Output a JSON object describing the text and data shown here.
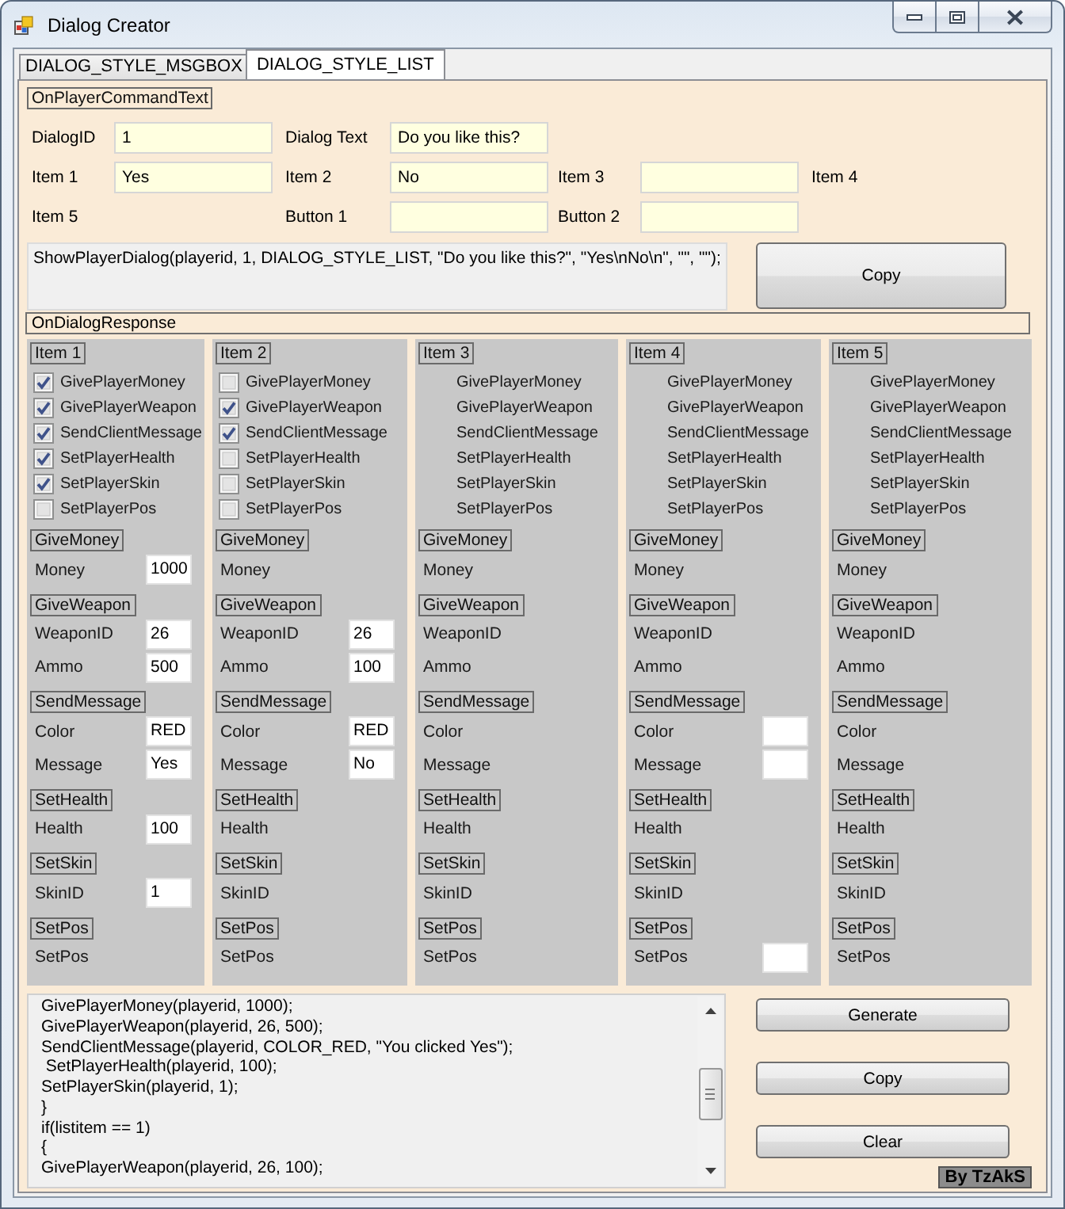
{
  "window": {
    "title": "Dialog Creator"
  },
  "tabs": [
    {
      "label": "DIALOG_STYLE_MSGBOX",
      "selected": false
    },
    {
      "label": "DIALOG_STYLE_LIST",
      "selected": true
    }
  ],
  "command_section": {
    "title": "OnPlayerCommandText",
    "rows": [
      [
        {
          "label": "DialogID",
          "field": true,
          "value": "1"
        },
        {
          "label": "Dialog Text",
          "field": true,
          "value": "Do you like this?"
        }
      ],
      [
        {
          "label": "Item 1",
          "field": true,
          "value": "Yes"
        },
        {
          "label": "Item 2",
          "field": true,
          "value": "No"
        },
        {
          "label": "Item 3",
          "field": true
        },
        {
          "label": "Item 4",
          "field": false
        }
      ],
      [
        {
          "label": "Item 5",
          "field": false
        },
        {
          "label": "Button 1",
          "field": true
        },
        {
          "label": "Button 2",
          "field": true
        }
      ]
    ],
    "output": "ShowPlayerDialog(playerid, 1, DIALOG_STYLE_LIST, \"Do you like this?\", \"Yes\\nNo\\n\", \"\", \"\");",
    "copy_button": "Copy"
  },
  "response_section": {
    "title": "OnDialogResponse",
    "panels": [
      {
        "kind": "checklist",
        "title": "Item 1",
        "options": [
          {
            "label": "GivePlayerMoney",
            "checked": true
          },
          {
            "label": "GivePlayerWeapon",
            "checked": true
          },
          {
            "label": "SendClientMessage",
            "checked": true
          },
          {
            "label": "SetPlayerHealth",
            "checked": true
          },
          {
            "label": "SetPlayerSkin",
            "checked": true
          },
          {
            "label": "SetPlayerPos",
            "checked": false
          }
        ],
        "sections": [
          {
            "title": "GiveMoney",
            "fields": [
              {
                "label": "Money",
                "field": true,
                "value": "1000"
              }
            ]
          },
          {
            "title": "GiveWeapon",
            "fields": [
              {
                "label": "WeaponID",
                "field": true,
                "value": "26"
              },
              {
                "label": "Ammo",
                "field": true,
                "value": "500"
              }
            ]
          },
          {
            "title": "SendMessage",
            "fields": [
              {
                "label": "Color",
                "field": true,
                "value": "RED"
              },
              {
                "label": "Message",
                "field": true,
                "value": "Yes"
              }
            ]
          },
          {
            "title": "SetHealth",
            "fields": [
              {
                "label": "Health",
                "field": true,
                "value": "100"
              }
            ]
          },
          {
            "title": "SetSkin",
            "fields": [
              {
                "label": "SkinID",
                "field": true,
                "value": "1"
              }
            ]
          },
          {
            "title": "SetPos",
            "fields": [
              {
                "label": "SetPos",
                "field": false
              }
            ]
          }
        ]
      },
      {
        "kind": "checklist",
        "title": "Item 2",
        "options": [
          {
            "label": "GivePlayerMoney",
            "checked": false
          },
          {
            "label": "GivePlayerWeapon",
            "checked": true
          },
          {
            "label": "SendClientMessage",
            "checked": true
          },
          {
            "label": "SetPlayerHealth",
            "checked": false
          },
          {
            "label": "SetPlayerSkin",
            "checked": false
          },
          {
            "label": "SetPlayerPos",
            "checked": false
          }
        ],
        "sections": [
          {
            "title": "GiveMoney",
            "fields": [
              {
                "label": "Money",
                "field": false
              }
            ]
          },
          {
            "title": "GiveWeapon",
            "fields": [
              {
                "label": "WeaponID",
                "field": true,
                "value": "26"
              },
              {
                "label": "Ammo",
                "field": true,
                "value": "100"
              }
            ]
          },
          {
            "title": "SendMessage",
            "fields": [
              {
                "label": "Color",
                "field": true,
                "value": "RED"
              },
              {
                "label": "Message",
                "field": true,
                "value": "No"
              }
            ]
          },
          {
            "title": "SetHealth",
            "fields": [
              {
                "label": "Health",
                "field": false
              }
            ]
          },
          {
            "title": "SetSkin",
            "fields": [
              {
                "label": "SkinID",
                "field": false
              }
            ]
          },
          {
            "title": "SetPos",
            "fields": [
              {
                "label": "SetPos",
                "field": false
              }
            ]
          }
        ]
      },
      {
        "kind": "plain",
        "title": "Item 3",
        "options": [
          {
            "label": "GivePlayerMoney"
          },
          {
            "label": "GivePlayerWeapon"
          },
          {
            "label": "SendClientMessage"
          },
          {
            "label": "SetPlayerHealth"
          },
          {
            "label": "SetPlayerSkin"
          },
          {
            "label": "SetPlayerPos"
          }
        ],
        "sections": [
          {
            "title": "GiveMoney",
            "fields": [
              {
                "label": "Money",
                "field": false
              }
            ]
          },
          {
            "title": "GiveWeapon",
            "fields": [
              {
                "label": "WeaponID",
                "field": false
              },
              {
                "label": "Ammo",
                "field": false
              }
            ]
          },
          {
            "title": "SendMessage",
            "fields": [
              {
                "label": "Color",
                "field": false
              },
              {
                "label": "Message",
                "field": false
              }
            ]
          },
          {
            "title": "SetHealth",
            "fields": [
              {
                "label": "Health",
                "field": false
              }
            ]
          },
          {
            "title": "SetSkin",
            "fields": [
              {
                "label": "SkinID",
                "field": false
              }
            ]
          },
          {
            "title": "SetPos",
            "fields": [
              {
                "label": "SetPos",
                "field": false
              }
            ]
          }
        ]
      },
      {
        "kind": "plain",
        "title": "Item 4",
        "options": [
          {
            "label": "GivePlayerMoney"
          },
          {
            "label": "GivePlayerWeapon"
          },
          {
            "label": "SendClientMessage"
          },
          {
            "label": "SetPlayerHealth"
          },
          {
            "label": "SetPlayerSkin"
          },
          {
            "label": "SetPlayerPos"
          }
        ],
        "sections": [
          {
            "title": "GiveMoney",
            "fields": [
              {
                "label": "Money",
                "field": false
              }
            ]
          },
          {
            "title": "GiveWeapon",
            "fields": [
              {
                "label": "WeaponID",
                "field": false
              },
              {
                "label": "Ammo",
                "field": false
              }
            ]
          },
          {
            "title": "SendMessage",
            "fields": [
              {
                "label": "Color",
                "field": true
              },
              {
                "label": "Message",
                "field": true
              }
            ]
          },
          {
            "title": "SetHealth",
            "fields": [
              {
                "label": "Health",
                "field": false
              }
            ]
          },
          {
            "title": "SetSkin",
            "fields": [
              {
                "label": "SkinID",
                "field": false
              }
            ]
          },
          {
            "title": "SetPos",
            "fields": [
              {
                "label": "SetPos",
                "field": true
              }
            ]
          }
        ]
      },
      {
        "kind": "plain",
        "title": "Item 5",
        "options": [
          {
            "label": "GivePlayerMoney"
          },
          {
            "label": "GivePlayerWeapon"
          },
          {
            "label": "SendClientMessage"
          },
          {
            "label": "SetPlayerHealth"
          },
          {
            "label": "SetPlayerSkin"
          },
          {
            "label": "SetPlayerPos"
          }
        ],
        "sections": [
          {
            "title": "GiveMoney",
            "fields": [
              {
                "label": "Money",
                "field": false
              }
            ]
          },
          {
            "title": "GiveWeapon",
            "fields": [
              {
                "label": "WeaponID",
                "field": false
              },
              {
                "label": "Ammo",
                "field": false
              }
            ]
          },
          {
            "title": "SendMessage",
            "fields": [
              {
                "label": "Color",
                "field": false
              },
              {
                "label": "Message",
                "field": false
              }
            ]
          },
          {
            "title": "SetHealth",
            "fields": [
              {
                "label": "Health",
                "field": false
              }
            ]
          },
          {
            "title": "SetSkin",
            "fields": [
              {
                "label": "SkinID",
                "field": false
              }
            ]
          },
          {
            "title": "SetPos",
            "fields": [
              {
                "label": "SetPos",
                "field": false
              }
            ]
          }
        ]
      }
    ]
  },
  "code_panel": {
    "lines": [
      "GivePlayerMoney(playerid, 1000);",
      "GivePlayerWeapon(playerid, 26, 500);",
      "SendClientMessage(playerid, COLOR_RED, \"You clicked Yes\");",
      " SetPlayerHealth(playerid, 100);",
      "SetPlayerSkin(playerid, 1);",
      "}",
      "if(listitem == 1)",
      "{",
      "GivePlayerWeapon(playerid, 26, 100);"
    ],
    "buttons": [
      "Generate",
      "Copy",
      "Clear"
    ],
    "credit": "By TzAkS"
  }
}
